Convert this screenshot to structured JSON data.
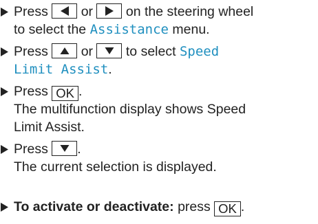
{
  "steps": [
    {
      "press1": "Press",
      "or1": "or",
      "text1": "on the steering wheel",
      "text2a": "to select the",
      "menu": "Assistance",
      "text2b": "menu."
    },
    {
      "press": "Press",
      "or": "or",
      "text1": "to select",
      "menu_line1": "Speed",
      "menu_line2": "Limit Assist",
      "period": "."
    },
    {
      "press": "Press",
      "key": "OK",
      "period": ".",
      "result_line1": "The multifunction display shows Speed",
      "result_line2": "Limit Assist."
    },
    {
      "press": "Press",
      "period": ".",
      "result": "The current selection is displayed."
    },
    {
      "bold": "To activate or deactivate:",
      "text": "press",
      "key": "OK",
      "period": "."
    }
  ],
  "icons": {
    "bullet": "triangle-bullet-icon",
    "left": "left-arrow-icon",
    "right": "right-arrow-icon",
    "up": "up-arrow-icon",
    "down": "down-arrow-icon"
  },
  "colors": {
    "text": "#222222",
    "menu_highlight": "#1f8fbf"
  }
}
